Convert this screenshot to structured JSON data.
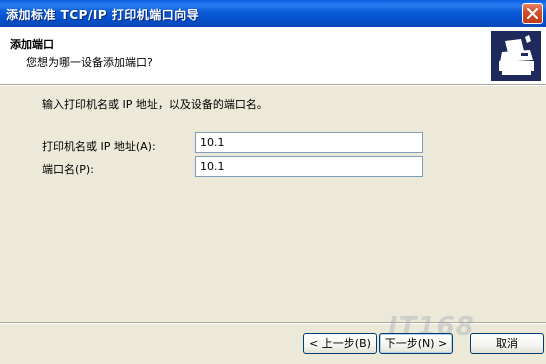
{
  "window": {
    "title": "添加标准 TCP/IP 打印机端口向导"
  },
  "header": {
    "title": "添加端口",
    "subtitle": "您想为哪一设备添加端口?"
  },
  "form": {
    "intro": "输入打印机名或 IP 地址，以及设备的端口名。",
    "printer_label": "打印机名或 IP 地址(A):",
    "printer_value": "10.1",
    "port_label": "端口名(P):",
    "port_value": "10.1"
  },
  "buttons": {
    "back": "< 上一步(B)",
    "next": "下一步(N) >",
    "cancel": "取消"
  },
  "watermark": "IT168",
  "icons": {
    "close": "close-icon",
    "printer": "printer-wizard-icon"
  },
  "colors": {
    "titlebar": "#0a5ee0",
    "close": "#c23c18",
    "dialog": "#ece9d8",
    "icon_bg": "#1f2a5c"
  }
}
